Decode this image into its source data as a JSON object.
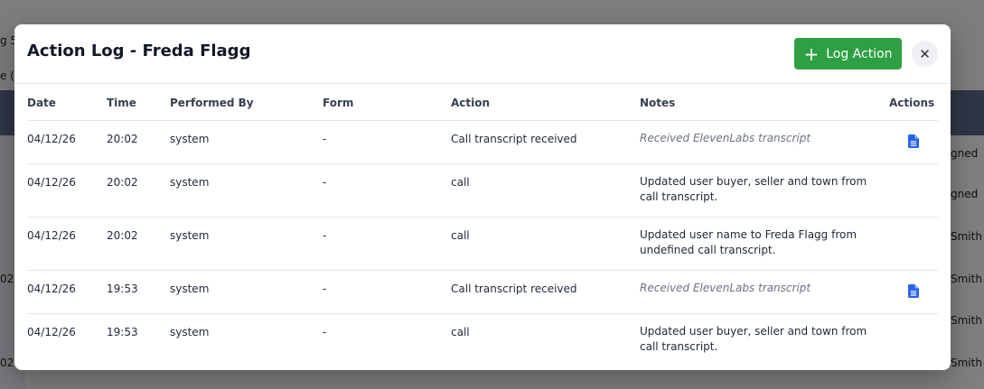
{
  "modal": {
    "title": "Action Log - Freda Flagg",
    "log_button_label": "Log Action",
    "close_glyph": "✕",
    "accent_color": "#2ea043"
  },
  "table": {
    "headers": {
      "date": "Date",
      "time": "Time",
      "performed_by": "Performed By",
      "form": "Form",
      "action": "Action",
      "notes": "Notes",
      "actions": "Actions"
    },
    "rows": [
      {
        "date": "04/12/26",
        "time": "20:02",
        "performed_by": "system",
        "form": "-",
        "action": "Call transcript received",
        "notes": "Received ElevenLabs transcript",
        "has_doc": true
      },
      {
        "date": "04/12/26",
        "time": "20:02",
        "performed_by": "system",
        "form": "-",
        "action": "call",
        "notes": "Updated user buyer, seller and town from call transcript.",
        "has_doc": false
      },
      {
        "date": "04/12/26",
        "time": "20:02",
        "performed_by": "system",
        "form": "-",
        "action": "call",
        "notes": "Updated user name to Freda Flagg from undefined call transcript.",
        "has_doc": false
      },
      {
        "date": "04/12/26",
        "time": "19:53",
        "performed_by": "system",
        "form": "-",
        "action": "Call transcript received",
        "notes": "Received ElevenLabs transcript",
        "has_doc": true
      },
      {
        "date": "04/12/26",
        "time": "19:53",
        "performed_by": "system",
        "form": "-",
        "action": "call",
        "notes": "Updated user buyer, seller and town from call transcript.",
        "has_doc": false
      }
    ]
  },
  "background": {
    "fragments": [
      "g 5(",
      "e (st",
      "02(",
      "02(",
      "gned",
      "gned",
      "Smith",
      "Smith",
      "Smith",
      "Smith"
    ]
  }
}
